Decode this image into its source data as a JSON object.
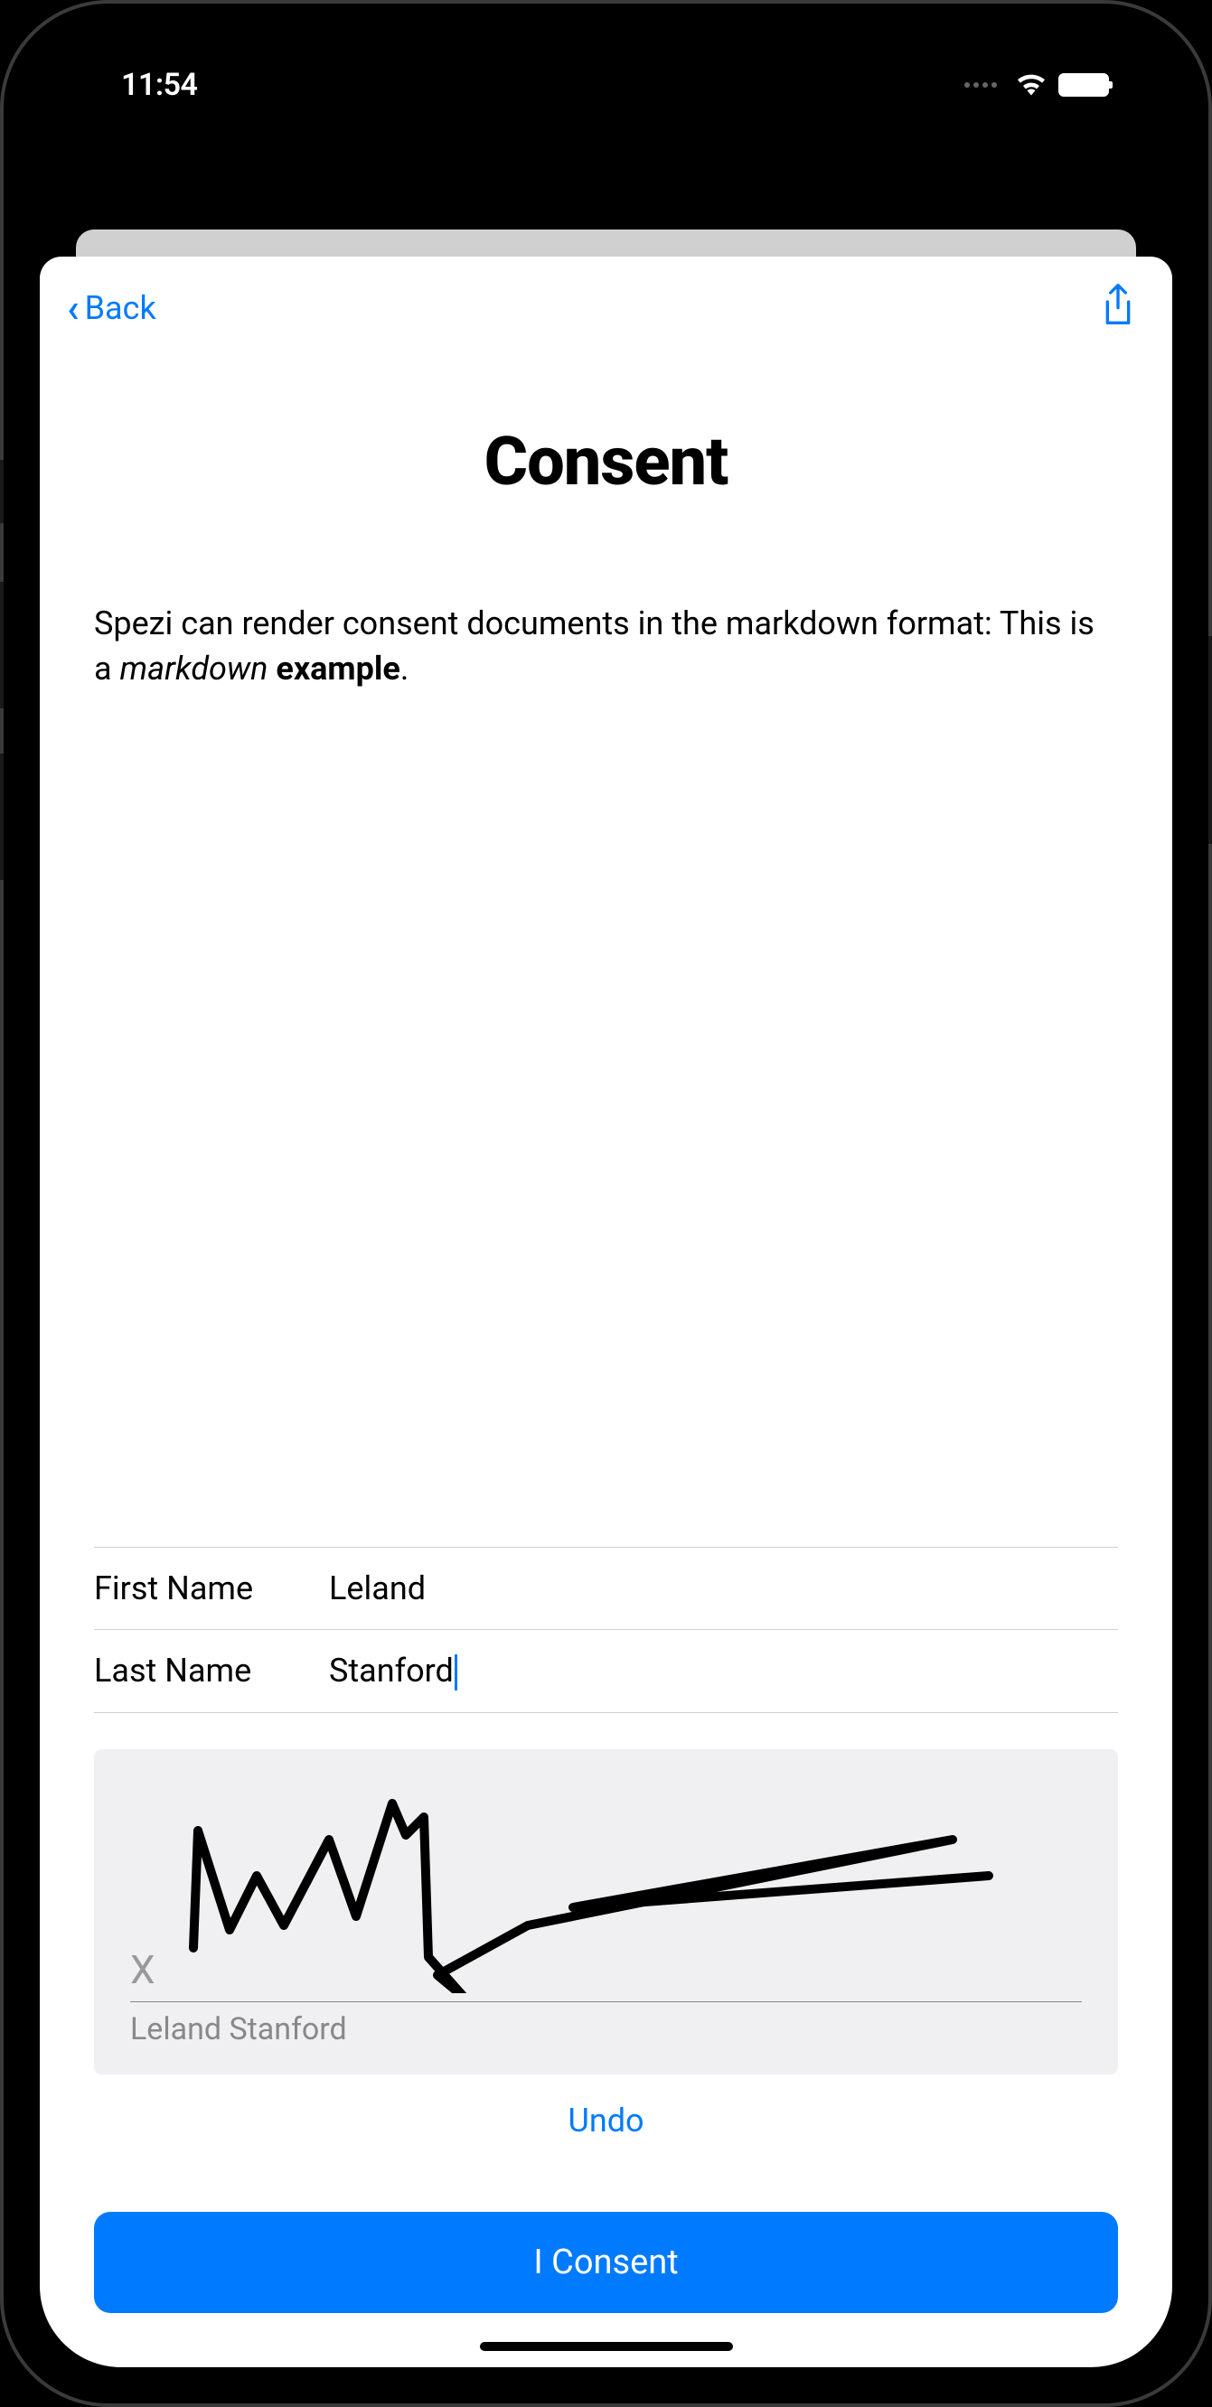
{
  "status": {
    "time": "11:54"
  },
  "nav": {
    "back_label": "Back"
  },
  "page": {
    "title": "Consent",
    "description_prefix": "Spezi can render consent documents in the markdown format: This is a ",
    "description_italic": "markdown",
    "description_space": " ",
    "description_bold": "example",
    "description_suffix": "."
  },
  "form": {
    "first_name_label": "First Name",
    "first_name_value": "Leland",
    "last_name_label": "Last Name",
    "last_name_value": "Stanford"
  },
  "signature": {
    "x_marker": "X",
    "name_preview": "Leland Stanford"
  },
  "actions": {
    "undo_label": "Undo",
    "consent_label": "I Consent"
  }
}
